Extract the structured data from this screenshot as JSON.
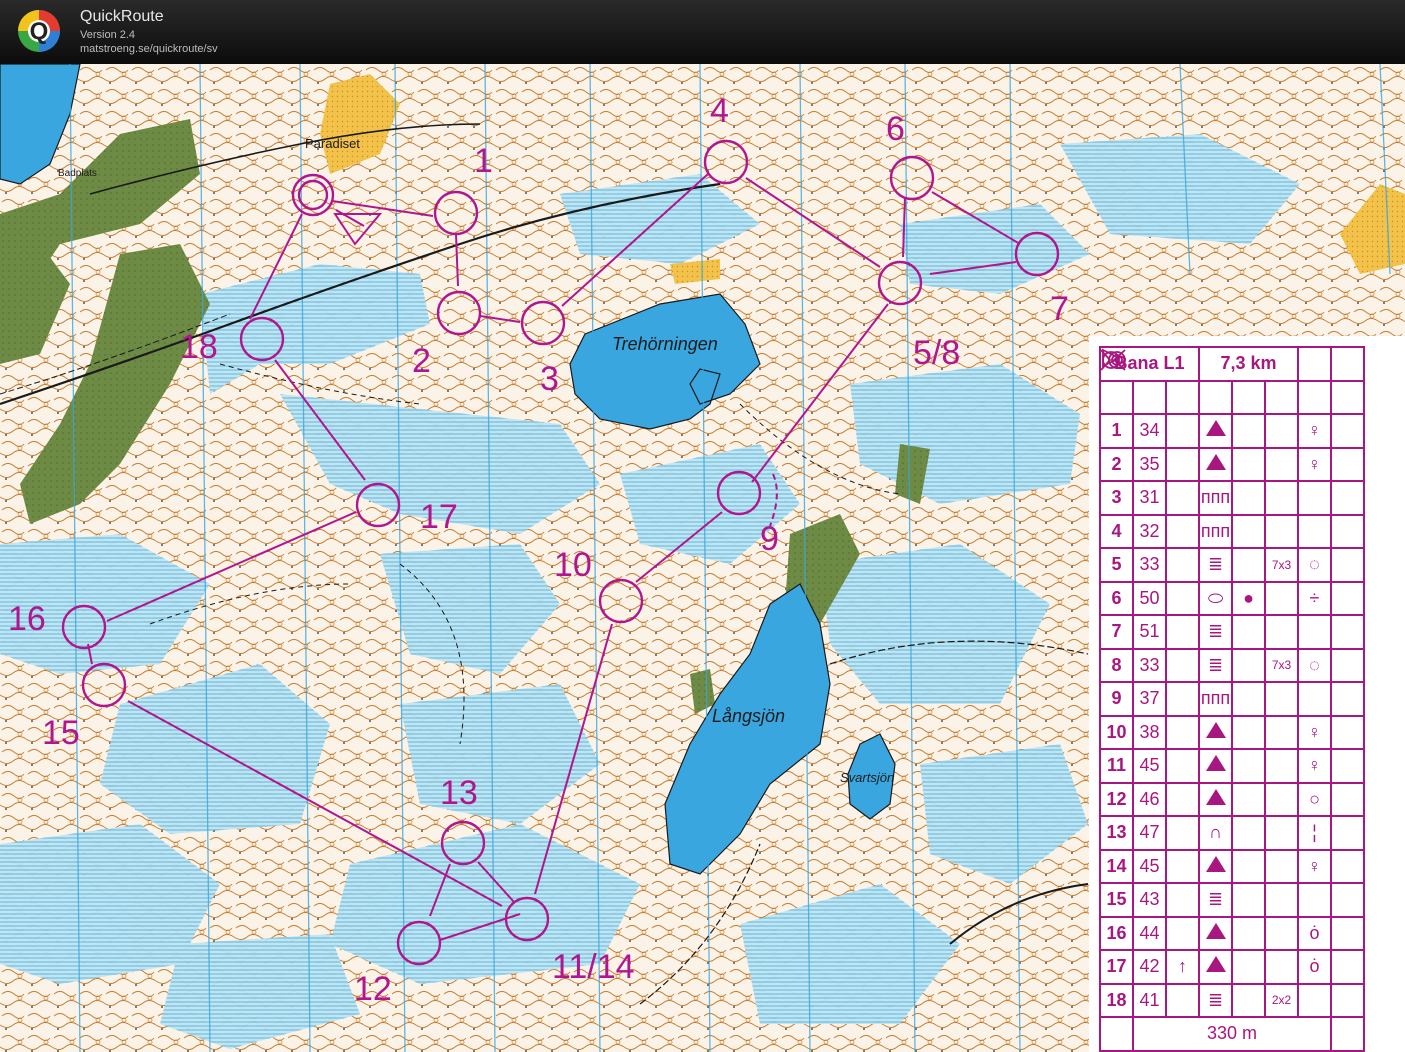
{
  "app": {
    "title": "QuickRoute",
    "version": "Version 2.4",
    "url": "matstroeng.se/quickroute/sv",
    "logo_letter": "Q"
  },
  "map": {
    "colors": {
      "course": "#b0168f",
      "water": "#3aa6df",
      "marsh": "#9fd6e8",
      "green": "#5f7b3a",
      "contour": "#c97a2a",
      "open": "#f2b83b"
    },
    "place_names": [
      {
        "id": "paradiset",
        "text": "Paradiset"
      },
      {
        "id": "badplats",
        "text": "Badplats"
      },
      {
        "id": "trehorningen",
        "text": "Trehörningen"
      },
      {
        "id": "langsjon",
        "text": "Långsjön"
      },
      {
        "id": "svartsjon",
        "text": "Svartsjön"
      }
    ],
    "control_labels": [
      "1",
      "2",
      "3",
      "4",
      "5/8",
      "6",
      "7",
      "9",
      "10",
      "11/14",
      "12",
      "13",
      "15",
      "16",
      "17",
      "18"
    ]
  },
  "description": {
    "course": "Bana L1",
    "length": "7,3 km",
    "finish_distance": "330 m",
    "rows": [
      {
        "num": "1",
        "code": "34",
        "c": "",
        "d": "tri",
        "e": "",
        "f": "",
        "g": "♀"
      },
      {
        "num": "2",
        "code": "35",
        "c": "",
        "d": "tri",
        "e": "",
        "f": "",
        "g": "♀"
      },
      {
        "num": "3",
        "code": "31",
        "c": "",
        "d": "ᴨᴨᴨ",
        "e": "",
        "f": "",
        "g": ""
      },
      {
        "num": "4",
        "code": "32",
        "c": "",
        "d": "ᴨᴨᴨ",
        "e": "",
        "f": "",
        "g": ""
      },
      {
        "num": "5",
        "code": "33",
        "c": "",
        "d": "≣",
        "e": "",
        "f": "7x3",
        "g": "◌"
      },
      {
        "num": "6",
        "code": "50",
        "c": "",
        "d": "⬭",
        "e": "●",
        "f": "",
        "g": "÷"
      },
      {
        "num": "7",
        "code": "51",
        "c": "",
        "d": "≣",
        "e": "",
        "f": "",
        "g": ""
      },
      {
        "num": "8",
        "code": "33",
        "c": "",
        "d": "≣",
        "e": "",
        "f": "7x3",
        "g": "◌"
      },
      {
        "num": "9",
        "code": "37",
        "c": "",
        "d": "ᴨᴨᴨ",
        "e": "",
        "f": "",
        "g": ""
      },
      {
        "num": "10",
        "code": "38",
        "c": "",
        "d": "tri",
        "e": "",
        "f": "",
        "g": "♀"
      },
      {
        "num": "11",
        "code": "45",
        "c": "",
        "d": "tri",
        "e": "",
        "f": "",
        "g": "♀"
      },
      {
        "num": "12",
        "code": "46",
        "c": "",
        "d": "tri",
        "e": "",
        "f": "",
        "g": "○"
      },
      {
        "num": "13",
        "code": "47",
        "c": "",
        "d": "∩",
        "e": "",
        "f": "",
        "g": "¦"
      },
      {
        "num": "14",
        "code": "45",
        "c": "",
        "d": "tri",
        "e": "",
        "f": "",
        "g": "♀"
      },
      {
        "num": "15",
        "code": "43",
        "c": "",
        "d": "≣",
        "e": "",
        "f": "",
        "g": ""
      },
      {
        "num": "16",
        "code": "44",
        "c": "",
        "d": "tri",
        "e": "",
        "f": "",
        "g": "ȯ"
      },
      {
        "num": "17",
        "code": "42",
        "c": "↑",
        "d": "tri",
        "e": "",
        "f": "",
        "g": "ȯ"
      },
      {
        "num": "18",
        "code": "41",
        "c": "",
        "d": "≣",
        "e": "",
        "f": "2x2",
        "g": ""
      }
    ]
  }
}
